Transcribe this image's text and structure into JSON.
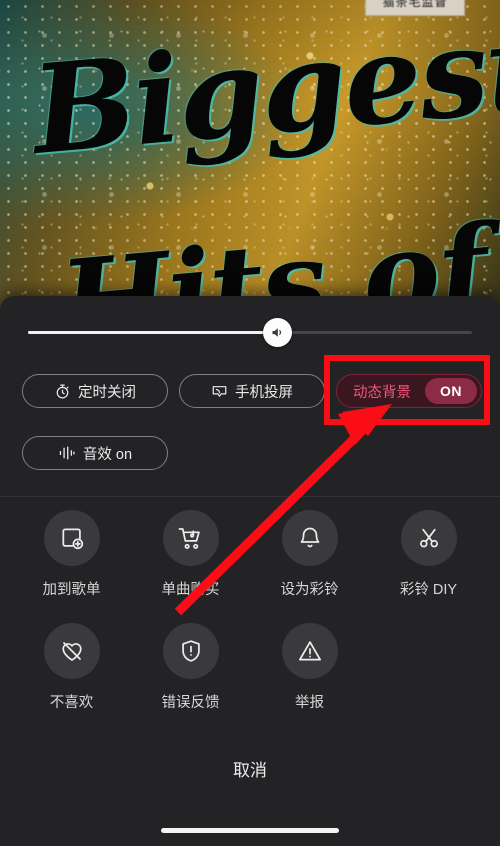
{
  "app": {
    "type": "music-player-bottom-sheet",
    "panel_bg": "#232326",
    "accent_pink": "#f0567a",
    "annotation_color": "#fa0d16"
  },
  "artwork": {
    "line1": "Biggest",
    "line2": "Hits of",
    "badge_text": "猫条毛监督",
    "palette": [
      "#1d4f4c",
      "#a8801f",
      "#c89a2a",
      "#46beaf"
    ]
  },
  "volume": {
    "name": "volume-slider",
    "value_percent": 56,
    "icon": "speaker-icon"
  },
  "pill_buttons": [
    {
      "id": "sleep-timer",
      "label": "定时关闭",
      "icon": "stopwatch-icon",
      "state": "off"
    },
    {
      "id": "screen-cast",
      "label": "手机投屏",
      "icon": "cast-icon",
      "state": "off"
    },
    {
      "id": "dynamic-background",
      "label": "动态背景",
      "icon": "none",
      "state": "on",
      "toggle_label": "ON"
    },
    {
      "id": "sound-effects",
      "label": "音效 on",
      "icon": "equalizer-icon",
      "state": "on"
    }
  ],
  "actions": [
    {
      "id": "add-to-playlist",
      "label": "加到歌单",
      "icon": "add-square-icon"
    },
    {
      "id": "buy-single",
      "label": "单曲购买",
      "icon": "shopping-cart-icon"
    },
    {
      "id": "set-ringback",
      "label": "设为彩铃",
      "icon": "bell-icon"
    },
    {
      "id": "ringback-diy",
      "label": "彩铃 DIY",
      "icon": "scissors-icon"
    },
    {
      "id": "dislike",
      "label": "不喜欢",
      "icon": "heart-broken-icon"
    },
    {
      "id": "error-feedback",
      "label": "错误反馈",
      "icon": "shield-alert-icon"
    },
    {
      "id": "report",
      "label": "举报",
      "icon": "warning-triangle-icon"
    }
  ],
  "cancel": {
    "label": "取消"
  }
}
